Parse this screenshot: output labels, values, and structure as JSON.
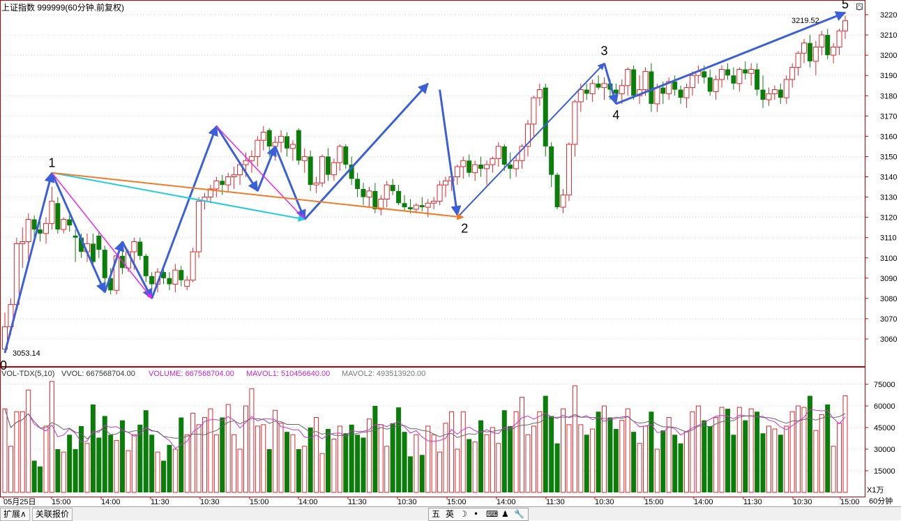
{
  "header": {
    "title": "上证指数 999999(60分钟.前复权)"
  },
  "price_panel": {
    "high_label": "3219.52",
    "low_label": "3053.14",
    "wave_labels": [
      "0",
      "1",
      "2",
      "3",
      "4",
      "5"
    ],
    "y_ticks": [
      3060,
      3070,
      3080,
      3090,
      3100,
      3110,
      3120,
      3130,
      3140,
      3150,
      3160,
      3170,
      3180,
      3190,
      3200,
      3210,
      3220
    ]
  },
  "volume_panel": {
    "legend": {
      "name": "VOL-TDX(5,10)",
      "vvol": "VVOL: 667568704.00",
      "volume": "VOLUME: 667568704.00",
      "mavol1": "MAVOL1: 510456640.00",
      "mavol2": "MAVOL2: 493513920.00"
    },
    "y_ticks": [
      "75000",
      "60000",
      "45000",
      "30000",
      "15000"
    ],
    "unit_label": "X1万"
  },
  "x_axis": {
    "labels": [
      "05月25日",
      "15:00",
      "14:00",
      "11:30",
      "10:30",
      "15:00",
      "14:00",
      "11:30",
      "10:30",
      "15:00",
      "14:00",
      "11:30",
      "10:30",
      "15:00",
      "14:00",
      "11:30",
      "10:30",
      "15:00"
    ],
    "period_label": "60分钟"
  },
  "statusbar": {
    "tab1": "扩展∧",
    "tab2": "关联报价",
    "ime_items": [
      "五",
      "英",
      "☽",
      "•",
      "⌨",
      "♟",
      "🔧"
    ]
  },
  "colors": {
    "up": "#e0262b",
    "down": "#0a7d0a",
    "wave": "#3b5fd9",
    "magenta": "#ee22ee",
    "cyan": "#22ccdd",
    "orange": "#f07c28",
    "ma1": "#cc33cc",
    "ma2": "#666666"
  },
  "chart_data": {
    "type": "candlestick",
    "title": "上证指数 999999(60分钟.前复权)",
    "price_range": [
      3050,
      3224
    ],
    "volume_range_wan": [
      0,
      80000
    ],
    "candles": [
      {
        "o": 3055,
        "h": 3073,
        "l": 3053.14,
        "c": 3066,
        "v": 58000
      },
      {
        "o": 3066,
        "h": 3080,
        "l": 3062,
        "c": 3077,
        "v": 32000
      },
      {
        "o": 3077,
        "h": 3110,
        "l": 3075,
        "c": 3107,
        "v": 56000
      },
      {
        "o": 3107,
        "h": 3115,
        "l": 3095,
        "c": 3108,
        "v": 56000
      },
      {
        "o": 3108,
        "h": 3122,
        "l": 3099,
        "c": 3119,
        "v": 71000
      },
      {
        "o": 3119,
        "h": 3121,
        "l": 3110,
        "c": 3114,
        "v": 22000
      },
      {
        "o": 3114,
        "h": 3118,
        "l": 3108,
        "c": 3112,
        "v": 18000
      },
      {
        "o": 3112,
        "h": 3120,
        "l": 3107,
        "c": 3117,
        "v": 46000
      },
      {
        "o": 3117,
        "h": 3135,
        "l": 3114,
        "c": 3128,
        "v": 77000
      },
      {
        "o": 3127,
        "h": 3130,
        "l": 3112,
        "c": 3114,
        "v": 30000
      },
      {
        "o": 3114,
        "h": 3120,
        "l": 3112,
        "c": 3119,
        "v": 28000
      },
      {
        "o": 3119,
        "h": 3121,
        "l": 3113,
        "c": 3116,
        "v": 40000
      },
      {
        "o": 3111,
        "h": 3114,
        "l": 3098,
        "c": 3110,
        "v": 30000
      },
      {
        "o": 3110,
        "h": 3112,
        "l": 3100,
        "c": 3103,
        "v": 46000
      },
      {
        "o": 3103,
        "h": 3112,
        "l": 3098,
        "c": 3107,
        "v": 34000
      },
      {
        "o": 3107,
        "h": 3112,
        "l": 3097,
        "c": 3098,
        "v": 61000
      },
      {
        "o": 3111,
        "h": 3113,
        "l": 3100,
        "c": 3104,
        "v": 38000
      },
      {
        "o": 3104,
        "h": 3106,
        "l": 3083,
        "c": 3090,
        "v": 53000
      },
      {
        "o": 3090,
        "h": 3095,
        "l": 3082,
        "c": 3084,
        "v": 40000
      },
      {
        "o": 3084,
        "h": 3102,
        "l": 3082,
        "c": 3101,
        "v": 36000
      },
      {
        "o": 3101,
        "h": 3104,
        "l": 3092,
        "c": 3095,
        "v": 50000
      },
      {
        "o": 3095,
        "h": 3104,
        "l": 3093,
        "c": 3103,
        "v": 29000
      },
      {
        "o": 3103,
        "h": 3110,
        "l": 3094,
        "c": 3108,
        "v": 40000
      },
      {
        "o": 3108,
        "h": 3110,
        "l": 3099,
        "c": 3101,
        "v": 47000
      },
      {
        "o": 3101,
        "h": 3102,
        "l": 3088,
        "c": 3091,
        "v": 57000
      },
      {
        "o": 3091,
        "h": 3093,
        "l": 3084,
        "c": 3087,
        "v": 40000
      },
      {
        "o": 3087,
        "h": 3095,
        "l": 3083,
        "c": 3093,
        "v": 28000
      },
      {
        "o": 3093,
        "h": 3096,
        "l": 3087,
        "c": 3090,
        "v": 22000
      },
      {
        "o": 3090,
        "h": 3093,
        "l": 3084,
        "c": 3087,
        "v": 33000
      },
      {
        "o": 3087,
        "h": 3097,
        "l": 3083,
        "c": 3094,
        "v": 30000
      },
      {
        "o": 3094,
        "h": 3096,
        "l": 3086,
        "c": 3089,
        "v": 52000
      },
      {
        "o": 3086,
        "h": 3091,
        "l": 3084,
        "c": 3089,
        "v": 40000
      },
      {
        "o": 3089,
        "h": 3105,
        "l": 3088,
        "c": 3103,
        "v": 55000
      },
      {
        "o": 3103,
        "h": 3130,
        "l": 3100,
        "c": 3128,
        "v": 47000
      },
      {
        "o": 3128,
        "h": 3132,
        "l": 3124,
        "c": 3130,
        "v": 52000
      },
      {
        "o": 3130,
        "h": 3136,
        "l": 3127,
        "c": 3134,
        "v": 58000
      },
      {
        "o": 3134,
        "h": 3140,
        "l": 3130,
        "c": 3138,
        "v": 40000
      },
      {
        "o": 3138,
        "h": 3141,
        "l": 3131,
        "c": 3136,
        "v": 52000
      },
      {
        "o": 3136,
        "h": 3142,
        "l": 3133,
        "c": 3140,
        "v": 61000
      },
      {
        "o": 3140,
        "h": 3145,
        "l": 3134,
        "c": 3141,
        "v": 40000
      },
      {
        "o": 3141,
        "h": 3147,
        "l": 3136,
        "c": 3146,
        "v": 30000
      },
      {
        "o": 3146,
        "h": 3152,
        "l": 3140,
        "c": 3148,
        "v": 60000
      },
      {
        "o": 3148,
        "h": 3153,
        "l": 3142,
        "c": 3150,
        "v": 72000
      },
      {
        "o": 3150,
        "h": 3160,
        "l": 3145,
        "c": 3158,
        "v": 46000
      },
      {
        "o": 3158,
        "h": 3165,
        "l": 3153,
        "c": 3162,
        "v": 47000
      },
      {
        "o": 3163,
        "h": 3164,
        "l": 3150,
        "c": 3155,
        "v": 30000
      },
      {
        "o": 3155,
        "h": 3160,
        "l": 3148,
        "c": 3157,
        "v": 57000
      },
      {
        "o": 3157,
        "h": 3163,
        "l": 3152,
        "c": 3160,
        "v": 48000
      },
      {
        "o": 3160,
        "h": 3162,
        "l": 3150,
        "c": 3154,
        "v": 42000
      },
      {
        "o": 3154,
        "h": 3158,
        "l": 3148,
        "c": 3156,
        "v": 40000
      },
      {
        "o": 3163,
        "h": 3164,
        "l": 3146,
        "c": 3148,
        "v": 30000
      },
      {
        "o": 3148,
        "h": 3154,
        "l": 3142,
        "c": 3150,
        "v": 32000
      },
      {
        "o": 3150,
        "h": 3153,
        "l": 3133,
        "c": 3136,
        "v": 45000
      },
      {
        "o": 3136,
        "h": 3140,
        "l": 3132,
        "c": 3137,
        "v": 52000
      },
      {
        "o": 3137,
        "h": 3151,
        "l": 3135,
        "c": 3150,
        "v": 27000
      },
      {
        "o": 3150,
        "h": 3154,
        "l": 3138,
        "c": 3141,
        "v": 44000
      },
      {
        "o": 3141,
        "h": 3149,
        "l": 3138,
        "c": 3147,
        "v": 37000
      },
      {
        "o": 3147,
        "h": 3156,
        "l": 3143,
        "c": 3155,
        "v": 46000
      },
      {
        "o": 3155,
        "h": 3156,
        "l": 3144,
        "c": 3146,
        "v": 41000
      },
      {
        "o": 3146,
        "h": 3150,
        "l": 3136,
        "c": 3139,
        "v": 47000
      },
      {
        "o": 3139,
        "h": 3142,
        "l": 3130,
        "c": 3134,
        "v": 40000
      },
      {
        "o": 3134,
        "h": 3137,
        "l": 3126,
        "c": 3130,
        "v": 38000
      },
      {
        "o": 3130,
        "h": 3135,
        "l": 3125,
        "c": 3133,
        "v": 51000
      },
      {
        "o": 3133,
        "h": 3137,
        "l": 3122,
        "c": 3124,
        "v": 60000
      },
      {
        "o": 3124,
        "h": 3131,
        "l": 3121,
        "c": 3129,
        "v": 47000
      },
      {
        "o": 3129,
        "h": 3138,
        "l": 3125,
        "c": 3136,
        "v": 32000
      },
      {
        "o": 3136,
        "h": 3139,
        "l": 3131,
        "c": 3133,
        "v": 48000
      },
      {
        "o": 3133,
        "h": 3136,
        "l": 3126,
        "c": 3127,
        "v": 59000
      },
      {
        "o": 3127,
        "h": 3131,
        "l": 3123,
        "c": 3125,
        "v": 42000
      },
      {
        "o": 3125,
        "h": 3129,
        "l": 3122,
        "c": 3124,
        "v": 25000
      },
      {
        "o": 3124,
        "h": 3127,
        "l": 3122,
        "c": 3126,
        "v": 40000
      },
      {
        "o": 3126,
        "h": 3130,
        "l": 3123,
        "c": 3125,
        "v": 26000
      },
      {
        "o": 3125,
        "h": 3129,
        "l": 3120,
        "c": 3127,
        "v": 46000
      },
      {
        "o": 3127,
        "h": 3130,
        "l": 3124,
        "c": 3128,
        "v": 40000
      },
      {
        "o": 3128,
        "h": 3138,
        "l": 3126,
        "c": 3136,
        "v": 28000
      },
      {
        "o": 3136,
        "h": 3140,
        "l": 3130,
        "c": 3138,
        "v": 48000
      },
      {
        "o": 3138,
        "h": 3143,
        "l": 3133,
        "c": 3140,
        "v": 56000
      },
      {
        "o": 3140,
        "h": 3146,
        "l": 3136,
        "c": 3145,
        "v": 30000
      },
      {
        "o": 3145,
        "h": 3150,
        "l": 3139,
        "c": 3148,
        "v": 56000
      },
      {
        "o": 3148,
        "h": 3151,
        "l": 3140,
        "c": 3142,
        "v": 37000
      },
      {
        "o": 3142,
        "h": 3148,
        "l": 3138,
        "c": 3146,
        "v": 35000
      },
      {
        "o": 3146,
        "h": 3150,
        "l": 3140,
        "c": 3144,
        "v": 50000
      },
      {
        "o": 3144,
        "h": 3148,
        "l": 3136,
        "c": 3146,
        "v": 40000
      },
      {
        "o": 3146,
        "h": 3150,
        "l": 3142,
        "c": 3149,
        "v": 45000
      },
      {
        "o": 3149,
        "h": 3157,
        "l": 3145,
        "c": 3155,
        "v": 34000
      },
      {
        "o": 3155,
        "h": 3156,
        "l": 3143,
        "c": 3146,
        "v": 57000
      },
      {
        "o": 3146,
        "h": 3152,
        "l": 3139,
        "c": 3144,
        "v": 46000
      },
      {
        "o": 3144,
        "h": 3150,
        "l": 3140,
        "c": 3148,
        "v": 56000
      },
      {
        "o": 3148,
        "h": 3156,
        "l": 3144,
        "c": 3155,
        "v": 66000
      },
      {
        "o": 3155,
        "h": 3168,
        "l": 3150,
        "c": 3166,
        "v": 40000
      },
      {
        "o": 3166,
        "h": 3180,
        "l": 3160,
        "c": 3179,
        "v": 46000
      },
      {
        "o": 3179,
        "h": 3186,
        "l": 3175,
        "c": 3183,
        "v": 56000
      },
      {
        "o": 3184,
        "h": 3186,
        "l": 3150,
        "c": 3155,
        "v": 67000
      },
      {
        "o": 3155,
        "h": 3157,
        "l": 3135,
        "c": 3141,
        "v": 53000
      },
      {
        "o": 3141,
        "h": 3142,
        "l": 3124,
        "c": 3125,
        "v": 34000
      },
      {
        "o": 3125,
        "h": 3134,
        "l": 3122,
        "c": 3131,
        "v": 58000
      },
      {
        "o": 3131,
        "h": 3157,
        "l": 3128,
        "c": 3156,
        "v": 47000
      },
      {
        "o": 3156,
        "h": 3178,
        "l": 3150,
        "c": 3177,
        "v": 74000
      },
      {
        "o": 3177,
        "h": 3186,
        "l": 3172,
        "c": 3183,
        "v": 47000
      },
      {
        "o": 3183,
        "h": 3186,
        "l": 3178,
        "c": 3181,
        "v": 40000
      },
      {
        "o": 3181,
        "h": 3188,
        "l": 3177,
        "c": 3186,
        "v": 44000
      },
      {
        "o": 3186,
        "h": 3190,
        "l": 3183,
        "c": 3184,
        "v": 56000
      },
      {
        "o": 3184,
        "h": 3189,
        "l": 3178,
        "c": 3186,
        "v": 60000
      },
      {
        "o": 3186,
        "h": 3188,
        "l": 3178,
        "c": 3183,
        "v": 52000
      },
      {
        "o": 3183,
        "h": 3186,
        "l": 3178,
        "c": 3181,
        "v": 44000
      },
      {
        "o": 3181,
        "h": 3188,
        "l": 3176,
        "c": 3185,
        "v": 50000
      },
      {
        "o": 3185,
        "h": 3194,
        "l": 3180,
        "c": 3193,
        "v": 58000
      },
      {
        "o": 3193,
        "h": 3195,
        "l": 3178,
        "c": 3180,
        "v": 42000
      },
      {
        "o": 3180,
        "h": 3190,
        "l": 3176,
        "c": 3183,
        "v": 34000
      },
      {
        "o": 3183,
        "h": 3194,
        "l": 3180,
        "c": 3192,
        "v": 46000
      },
      {
        "o": 3192,
        "h": 3196,
        "l": 3172,
        "c": 3176,
        "v": 56000
      },
      {
        "o": 3176,
        "h": 3186,
        "l": 3172,
        "c": 3184,
        "v": 30000
      },
      {
        "o": 3184,
        "h": 3187,
        "l": 3176,
        "c": 3181,
        "v": 43000
      },
      {
        "o": 3181,
        "h": 3189,
        "l": 3178,
        "c": 3187,
        "v": 52000
      },
      {
        "o": 3187,
        "h": 3190,
        "l": 3180,
        "c": 3183,
        "v": 40000
      },
      {
        "o": 3183,
        "h": 3185,
        "l": 3176,
        "c": 3179,
        "v": 34000
      },
      {
        "o": 3179,
        "h": 3186,
        "l": 3174,
        "c": 3184,
        "v": 42000
      },
      {
        "o": 3184,
        "h": 3192,
        "l": 3180,
        "c": 3190,
        "v": 56000
      },
      {
        "o": 3190,
        "h": 3195,
        "l": 3186,
        "c": 3192,
        "v": 60000
      },
      {
        "o": 3192,
        "h": 3195,
        "l": 3186,
        "c": 3189,
        "v": 50000
      },
      {
        "o": 3189,
        "h": 3193,
        "l": 3180,
        "c": 3182,
        "v": 46000
      },
      {
        "o": 3182,
        "h": 3190,
        "l": 3178,
        "c": 3188,
        "v": 52000
      },
      {
        "o": 3188,
        "h": 3195,
        "l": 3184,
        "c": 3193,
        "v": 59000
      },
      {
        "o": 3193,
        "h": 3196,
        "l": 3188,
        "c": 3190,
        "v": 58000
      },
      {
        "o": 3190,
        "h": 3194,
        "l": 3183,
        "c": 3186,
        "v": 40000
      },
      {
        "o": 3186,
        "h": 3194,
        "l": 3182,
        "c": 3193,
        "v": 59000
      },
      {
        "o": 3193,
        "h": 3197,
        "l": 3188,
        "c": 3191,
        "v": 50000
      },
      {
        "o": 3191,
        "h": 3196,
        "l": 3185,
        "c": 3193,
        "v": 58000
      },
      {
        "o": 3193,
        "h": 3196,
        "l": 3180,
        "c": 3183,
        "v": 56000
      },
      {
        "o": 3183,
        "h": 3190,
        "l": 3174,
        "c": 3178,
        "v": 41000
      },
      {
        "o": 3178,
        "h": 3184,
        "l": 3175,
        "c": 3181,
        "v": 46000
      },
      {
        "o": 3181,
        "h": 3185,
        "l": 3178,
        "c": 3183,
        "v": 44000
      },
      {
        "o": 3183,
        "h": 3186,
        "l": 3176,
        "c": 3179,
        "v": 40000
      },
      {
        "o": 3179,
        "h": 3190,
        "l": 3176,
        "c": 3188,
        "v": 46000
      },
      {
        "o": 3188,
        "h": 3196,
        "l": 3184,
        "c": 3194,
        "v": 56000
      },
      {
        "o": 3194,
        "h": 3202,
        "l": 3190,
        "c": 3201,
        "v": 60000
      },
      {
        "o": 3201,
        "h": 3208,
        "l": 3196,
        "c": 3206,
        "v": 59000
      },
      {
        "o": 3206,
        "h": 3210,
        "l": 3194,
        "c": 3197,
        "v": 67000
      },
      {
        "o": 3197,
        "h": 3207,
        "l": 3190,
        "c": 3204,
        "v": 43000
      },
      {
        "o": 3204,
        "h": 3212,
        "l": 3200,
        "c": 3210,
        "v": 54000
      },
      {
        "o": 3210,
        "h": 3213,
        "l": 3198,
        "c": 3200,
        "v": 61000
      },
      {
        "o": 3200,
        "h": 3206,
        "l": 3196,
        "c": 3204,
        "v": 32000
      },
      {
        "o": 3204,
        "h": 3213,
        "l": 3200,
        "c": 3212,
        "v": 48000
      },
      {
        "o": 3212,
        "h": 3219.52,
        "l": 3208,
        "c": 3217,
        "v": 67000
      }
    ],
    "waves": [
      {
        "label": "0",
        "price": 3053.14
      },
      {
        "label": "1",
        "price": 3142
      },
      {
        "label": "2",
        "price": 3120
      },
      {
        "label": "3",
        "price": 3196
      },
      {
        "label": "4",
        "price": 3176
      },
      {
        "label": "5",
        "price": 3221
      }
    ],
    "y_tick_values": [
      3060,
      3070,
      3080,
      3090,
      3100,
      3110,
      3120,
      3130,
      3140,
      3150,
      3160,
      3170,
      3180,
      3190,
      3200,
      3210,
      3220
    ],
    "volume_ticks_wan": [
      75000,
      60000,
      45000,
      30000,
      15000
    ]
  }
}
